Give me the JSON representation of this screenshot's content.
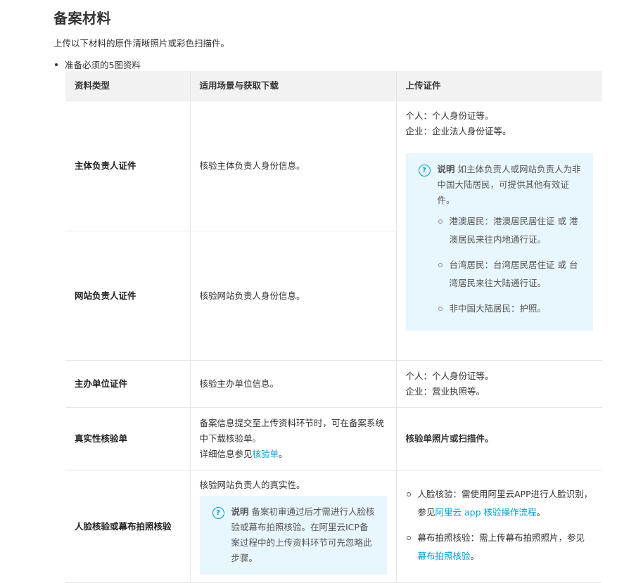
{
  "title": "备案材料",
  "intro": "上传以下材料的原件清晰照片或彩色扫描件。",
  "bullet": "准备必须的5图资料",
  "table": {
    "headers": [
      "资料类型",
      "适用场景与获取下载",
      "上传证件"
    ],
    "row1": {
      "type": "主体负责人证件",
      "scene": "核验主体负责人身份信息。",
      "upload_line1": "个人：个人身份证等。",
      "upload_line2": "企业：企业法人身份证等。",
      "note_label": "说明",
      "note_text": "如主体负责人或网站负责人为非中国大陆居民，可提供其他有效证件。",
      "note_items": [
        "港澳居民：港澳居民居住证 或 港澳居民来往内地通行证。",
        "台湾居民：台湾居民居住证 或 台湾居民来往大陆通行证。",
        "非中国大陆居民：护照。"
      ]
    },
    "row2": {
      "type": "网站负责人证件",
      "scene": "核验网站负责人身份信息。"
    },
    "row3": {
      "type": "主办单位证件",
      "scene": "核验主办单位信息。",
      "upload_line1": "个人：个人身份证等。",
      "upload_line2": "企业：营业执照等。"
    },
    "row4": {
      "type": "真实性核验单",
      "scene_text": "备案信息提交至上传资料环节时，可在备案系统中下载核验单。",
      "scene_more_prefix": "详细信息参见",
      "scene_link": "核验单",
      "scene_more_suffix": "。",
      "upload": "核验单照片或扫描件。"
    },
    "row5": {
      "type": "人脸核验或幕布拍照核验",
      "scene": "核验网站负责人的真实性。",
      "note_label": "说明",
      "note_text": "备案初审通过后才需进行人脸核验或幕布拍照核验。在阿里云ICP备案过程中的上传资料环节可先忽略此步骤。",
      "item1_prefix": "人脸核验：需使用阿里云APP进行人脸识别，参见",
      "item1_link": "阿里云 app 核验操作流程",
      "item1_suffix": "。",
      "item2_prefix": "幕布拍照核验：需上传幕布拍照照片，参见",
      "item2_link": "幕布拍照核验",
      "item2_suffix": "。"
    }
  },
  "colors": {
    "note_bg": "#e8f6fd",
    "link": "#00a1d6",
    "header_bg": "#f2f2f2"
  },
  "icons": {
    "note": "question-circle-icon"
  }
}
